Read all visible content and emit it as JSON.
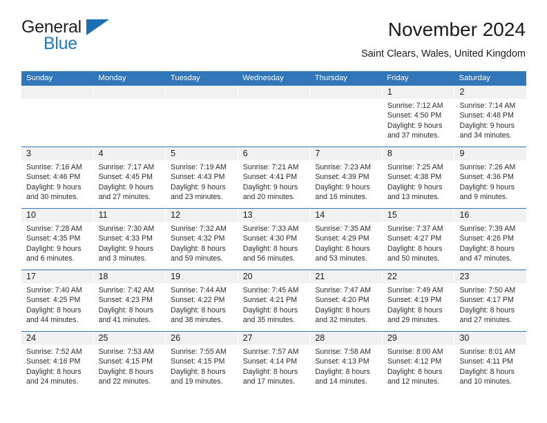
{
  "brand": {
    "line1": "General",
    "line2": "Blue",
    "triangle_color": "#1b6fb5",
    "text_color": "#231f20",
    "blue_text_color": "#1b7ac4"
  },
  "header": {
    "title": "November 2024",
    "subtitle": "Saint Clears, Wales, United Kingdom"
  },
  "theme": {
    "header_blue": "#3176b9",
    "day_band_gray": "#f1f1f1",
    "text": "#1a1a1a"
  },
  "weekday_headers": [
    "Sunday",
    "Monday",
    "Tuesday",
    "Wednesday",
    "Thursday",
    "Friday",
    "Saturday"
  ],
  "weeks": [
    [
      {
        "day": "",
        "empty": true,
        "sunrise": "",
        "sunset": "",
        "daylight_1": "",
        "daylight_2": ""
      },
      {
        "day": "",
        "empty": true,
        "sunrise": "",
        "sunset": "",
        "daylight_1": "",
        "daylight_2": ""
      },
      {
        "day": "",
        "empty": true,
        "sunrise": "",
        "sunset": "",
        "daylight_1": "",
        "daylight_2": ""
      },
      {
        "day": "",
        "empty": true,
        "sunrise": "",
        "sunset": "",
        "daylight_1": "",
        "daylight_2": ""
      },
      {
        "day": "",
        "empty": true,
        "sunrise": "",
        "sunset": "",
        "daylight_1": "",
        "daylight_2": ""
      },
      {
        "day": "1",
        "empty": false,
        "sunrise": "Sunrise: 7:12 AM",
        "sunset": "Sunset: 4:50 PM",
        "daylight_1": "Daylight: 9 hours",
        "daylight_2": "and 37 minutes."
      },
      {
        "day": "2",
        "empty": false,
        "sunrise": "Sunrise: 7:14 AM",
        "sunset": "Sunset: 4:48 PM",
        "daylight_1": "Daylight: 9 hours",
        "daylight_2": "and 34 minutes."
      }
    ],
    [
      {
        "day": "3",
        "empty": false,
        "sunrise": "Sunrise: 7:16 AM",
        "sunset": "Sunset: 4:46 PM",
        "daylight_1": "Daylight: 9 hours",
        "daylight_2": "and 30 minutes."
      },
      {
        "day": "4",
        "empty": false,
        "sunrise": "Sunrise: 7:17 AM",
        "sunset": "Sunset: 4:45 PM",
        "daylight_1": "Daylight: 9 hours",
        "daylight_2": "and 27 minutes."
      },
      {
        "day": "5",
        "empty": false,
        "sunrise": "Sunrise: 7:19 AM",
        "sunset": "Sunset: 4:43 PM",
        "daylight_1": "Daylight: 9 hours",
        "daylight_2": "and 23 minutes."
      },
      {
        "day": "6",
        "empty": false,
        "sunrise": "Sunrise: 7:21 AM",
        "sunset": "Sunset: 4:41 PM",
        "daylight_1": "Daylight: 9 hours",
        "daylight_2": "and 20 minutes."
      },
      {
        "day": "7",
        "empty": false,
        "sunrise": "Sunrise: 7:23 AM",
        "sunset": "Sunset: 4:39 PM",
        "daylight_1": "Daylight: 9 hours",
        "daylight_2": "and 16 minutes."
      },
      {
        "day": "8",
        "empty": false,
        "sunrise": "Sunrise: 7:25 AM",
        "sunset": "Sunset: 4:38 PM",
        "daylight_1": "Daylight: 9 hours",
        "daylight_2": "and 13 minutes."
      },
      {
        "day": "9",
        "empty": false,
        "sunrise": "Sunrise: 7:26 AM",
        "sunset": "Sunset: 4:36 PM",
        "daylight_1": "Daylight: 9 hours",
        "daylight_2": "and 9 minutes."
      }
    ],
    [
      {
        "day": "10",
        "empty": false,
        "sunrise": "Sunrise: 7:28 AM",
        "sunset": "Sunset: 4:35 PM",
        "daylight_1": "Daylight: 9 hours",
        "daylight_2": "and 6 minutes."
      },
      {
        "day": "11",
        "empty": false,
        "sunrise": "Sunrise: 7:30 AM",
        "sunset": "Sunset: 4:33 PM",
        "daylight_1": "Daylight: 9 hours",
        "daylight_2": "and 3 minutes."
      },
      {
        "day": "12",
        "empty": false,
        "sunrise": "Sunrise: 7:32 AM",
        "sunset": "Sunset: 4:32 PM",
        "daylight_1": "Daylight: 8 hours",
        "daylight_2": "and 59 minutes."
      },
      {
        "day": "13",
        "empty": false,
        "sunrise": "Sunrise: 7:33 AM",
        "sunset": "Sunset: 4:30 PM",
        "daylight_1": "Daylight: 8 hours",
        "daylight_2": "and 56 minutes."
      },
      {
        "day": "14",
        "empty": false,
        "sunrise": "Sunrise: 7:35 AM",
        "sunset": "Sunset: 4:29 PM",
        "daylight_1": "Daylight: 8 hours",
        "daylight_2": "and 53 minutes."
      },
      {
        "day": "15",
        "empty": false,
        "sunrise": "Sunrise: 7:37 AM",
        "sunset": "Sunset: 4:27 PM",
        "daylight_1": "Daylight: 8 hours",
        "daylight_2": "and 50 minutes."
      },
      {
        "day": "16",
        "empty": false,
        "sunrise": "Sunrise: 7:39 AM",
        "sunset": "Sunset: 4:26 PM",
        "daylight_1": "Daylight: 8 hours",
        "daylight_2": "and 47 minutes."
      }
    ],
    [
      {
        "day": "17",
        "empty": false,
        "sunrise": "Sunrise: 7:40 AM",
        "sunset": "Sunset: 4:25 PM",
        "daylight_1": "Daylight: 8 hours",
        "daylight_2": "and 44 minutes."
      },
      {
        "day": "18",
        "empty": false,
        "sunrise": "Sunrise: 7:42 AM",
        "sunset": "Sunset: 4:23 PM",
        "daylight_1": "Daylight: 8 hours",
        "daylight_2": "and 41 minutes."
      },
      {
        "day": "19",
        "empty": false,
        "sunrise": "Sunrise: 7:44 AM",
        "sunset": "Sunset: 4:22 PM",
        "daylight_1": "Daylight: 8 hours",
        "daylight_2": "and 38 minutes."
      },
      {
        "day": "20",
        "empty": false,
        "sunrise": "Sunrise: 7:45 AM",
        "sunset": "Sunset: 4:21 PM",
        "daylight_1": "Daylight: 8 hours",
        "daylight_2": "and 35 minutes."
      },
      {
        "day": "21",
        "empty": false,
        "sunrise": "Sunrise: 7:47 AM",
        "sunset": "Sunset: 4:20 PM",
        "daylight_1": "Daylight: 8 hours",
        "daylight_2": "and 32 minutes."
      },
      {
        "day": "22",
        "empty": false,
        "sunrise": "Sunrise: 7:49 AM",
        "sunset": "Sunset: 4:19 PM",
        "daylight_1": "Daylight: 8 hours",
        "daylight_2": "and 29 minutes."
      },
      {
        "day": "23",
        "empty": false,
        "sunrise": "Sunrise: 7:50 AM",
        "sunset": "Sunset: 4:17 PM",
        "daylight_1": "Daylight: 8 hours",
        "daylight_2": "and 27 minutes."
      }
    ],
    [
      {
        "day": "24",
        "empty": false,
        "sunrise": "Sunrise: 7:52 AM",
        "sunset": "Sunset: 4:16 PM",
        "daylight_1": "Daylight: 8 hours",
        "daylight_2": "and 24 minutes."
      },
      {
        "day": "25",
        "empty": false,
        "sunrise": "Sunrise: 7:53 AM",
        "sunset": "Sunset: 4:15 PM",
        "daylight_1": "Daylight: 8 hours",
        "daylight_2": "and 22 minutes."
      },
      {
        "day": "26",
        "empty": false,
        "sunrise": "Sunrise: 7:55 AM",
        "sunset": "Sunset: 4:15 PM",
        "daylight_1": "Daylight: 8 hours",
        "daylight_2": "and 19 minutes."
      },
      {
        "day": "27",
        "empty": false,
        "sunrise": "Sunrise: 7:57 AM",
        "sunset": "Sunset: 4:14 PM",
        "daylight_1": "Daylight: 8 hours",
        "daylight_2": "and 17 minutes."
      },
      {
        "day": "28",
        "empty": false,
        "sunrise": "Sunrise: 7:58 AM",
        "sunset": "Sunset: 4:13 PM",
        "daylight_1": "Daylight: 8 hours",
        "daylight_2": "and 14 minutes."
      },
      {
        "day": "29",
        "empty": false,
        "sunrise": "Sunrise: 8:00 AM",
        "sunset": "Sunset: 4:12 PM",
        "daylight_1": "Daylight: 8 hours",
        "daylight_2": "and 12 minutes."
      },
      {
        "day": "30",
        "empty": false,
        "sunrise": "Sunrise: 8:01 AM",
        "sunset": "Sunset: 4:11 PM",
        "daylight_1": "Daylight: 8 hours",
        "daylight_2": "and 10 minutes."
      }
    ]
  ]
}
